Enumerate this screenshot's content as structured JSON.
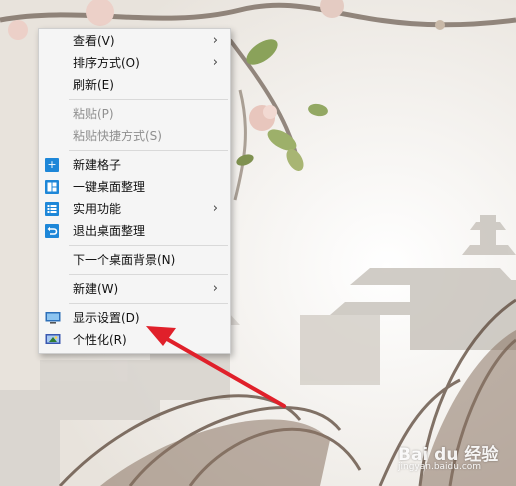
{
  "menu": {
    "items": [
      {
        "label": "查看(V)",
        "submenu": true
      },
      {
        "label": "排序方式(O)",
        "submenu": true
      },
      {
        "label": "刷新(E)"
      },
      {
        "label": "粘贴(P)",
        "disabled": true
      },
      {
        "label": "粘贴快捷方式(S)",
        "disabled": true
      },
      {
        "label": "新建格子",
        "icon": "plus-icon"
      },
      {
        "label": "一键桌面整理",
        "icon": "layout-icon"
      },
      {
        "label": "实用功能",
        "icon": "list-icon",
        "submenu": true
      },
      {
        "label": "退出桌面整理",
        "icon": "undo-icon"
      },
      {
        "label": "下一个桌面背景(N)"
      },
      {
        "label": "新建(W)",
        "submenu": true
      },
      {
        "label": "显示设置(D)",
        "icon": "monitor-icon"
      },
      {
        "label": "个性化(R)",
        "icon": "personalize-icon"
      }
    ],
    "submenu_glyph": "›",
    "accent_color": "#1e87d8"
  },
  "annotation": {
    "color": "#e0202a"
  },
  "watermark": {
    "logo": "Bai du 经验",
    "url": "jingyan.baidu.com"
  }
}
